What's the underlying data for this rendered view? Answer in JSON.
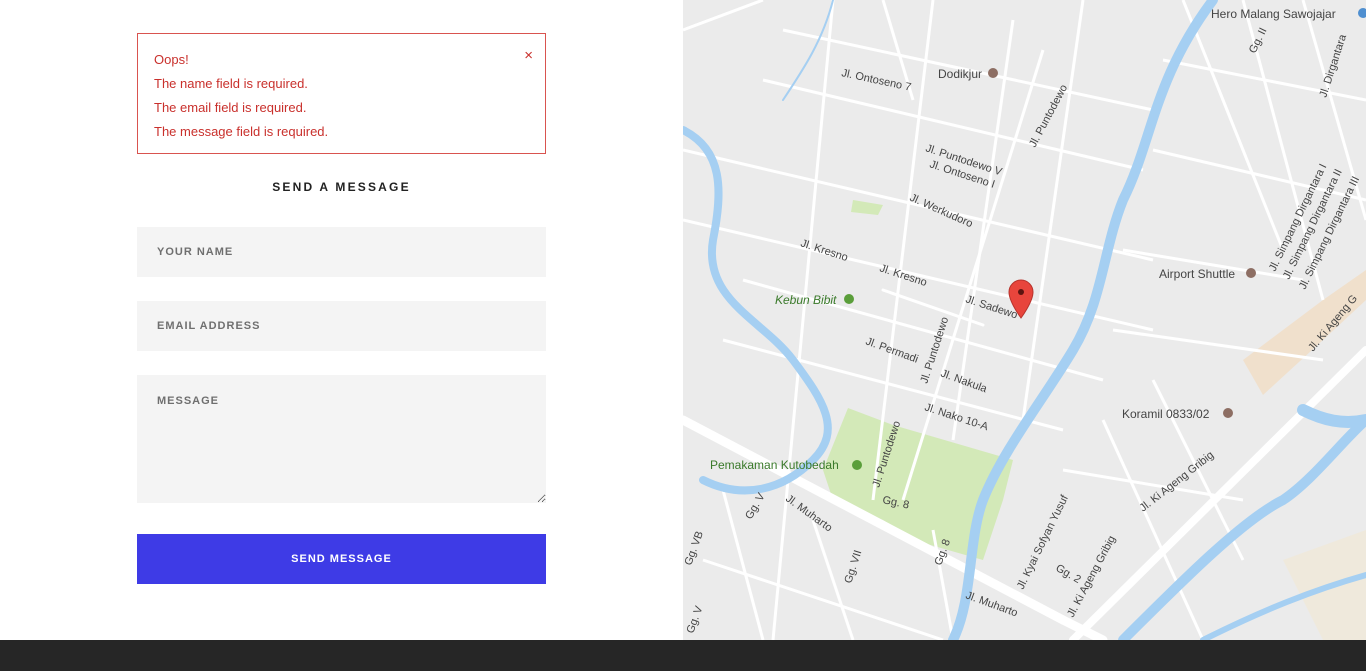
{
  "alert": {
    "title": "Oops!",
    "messages": [
      "The name field is required.",
      "The email field is required.",
      "The message field is required."
    ],
    "close_label": "×"
  },
  "form": {
    "title": "SEND A MESSAGE",
    "name_placeholder": "YOUR NAME",
    "email_placeholder": "EMAIL ADDRESS",
    "message_placeholder": "MESSAGE",
    "submit_label": "SEND MESSAGE"
  },
  "map": {
    "labels": {
      "hero": "Hero Malang Sawojajar",
      "dodikjur": "Dodikjur",
      "ontoseno7": "Jl. Ontoseno 7",
      "puntodewo_top": "Jl. Puntodewo",
      "puntodewo_v": "Jl. Puntodewo V",
      "ontoseno_i": "Jl. Ontoseno I",
      "werkudoro": "Jl. Werkudoro",
      "kresno1": "Jl. Kresno",
      "kresno2": "Jl. Kresno",
      "sadewo": "Jl. Sadewo",
      "kebun_bibit": "Kebun Bibit",
      "permadi": "Jl. Permadi",
      "puntodewo_mid": "Jl. Puntodewo",
      "nakula": "Jl. Nakula",
      "nako": "Jl. Nako 10-A",
      "airport_shuttle": "Airport Shuttle",
      "koramil": "Koramil 0833/02",
      "pemakaman": "Pemakaman Kutobedah",
      "puntodewo_low": "Jl. Puntodewo",
      "muharto1": "Jl. Muharto",
      "muharto2": "Jl. Muharto",
      "gg8": "Gg. 8",
      "gg8b": "Gg. 8",
      "ggv": "Gg. V",
      "ggvb": "Gg. VB",
      "ggvii": "Gg. VII",
      "ggv2": "Gg. V",
      "kyai": "Jl. Kyai Sofyan Yusuf",
      "gg2": "Gg. 2",
      "ageng_gribig1": "Jl. Ki Ageng Gribig",
      "ageng_gribig2": "Jl. Ki Ageng Gribig",
      "ageng_right": "Jl. Ki Ageng G",
      "dirgantara": "Jl. Dirgantara",
      "gg_ii": "Gg. II",
      "simpang1": "Jl. Simpang Dirgantara I",
      "simpang2": "Jl. Simpang Dirgantara II",
      "simpang3": "Jl. Simpang Dirgantara III"
    },
    "colors": {
      "background": "#ebebeb",
      "road": "#ffffff",
      "water": "#a5cff2",
      "park": "#d3e9b8",
      "marker": "#e8453c",
      "label": "#444444",
      "park_label": "#3a7a2a"
    }
  }
}
